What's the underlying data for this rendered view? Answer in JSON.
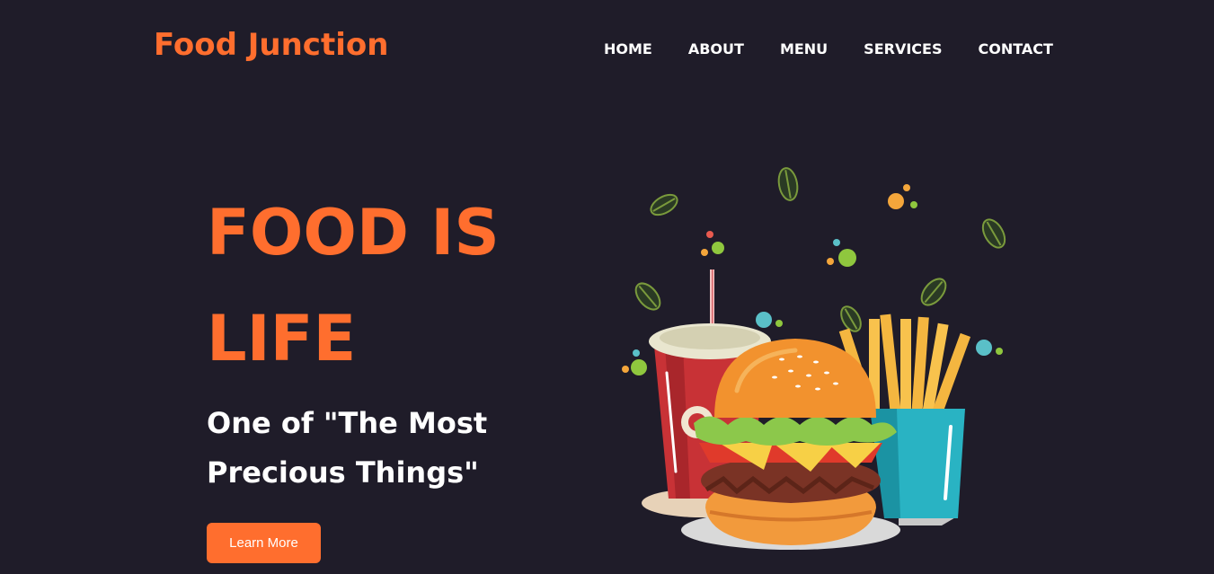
{
  "header": {
    "brand": "Food Junction",
    "nav": [
      "HOME",
      "ABOUT",
      "MENU",
      "SERVICES",
      "CONTACT"
    ]
  },
  "hero": {
    "title": "FOOD IS LIFE",
    "subtitle": "One of \"The Most Precious Things\"",
    "button_label": "Learn More"
  },
  "illustration": {
    "items": [
      "soda-cup",
      "burger",
      "french-fries",
      "leaves",
      "dots"
    ]
  },
  "colors": {
    "background": "#1f1c29",
    "accent": "#ff6e2e",
    "text": "#ffffff"
  }
}
